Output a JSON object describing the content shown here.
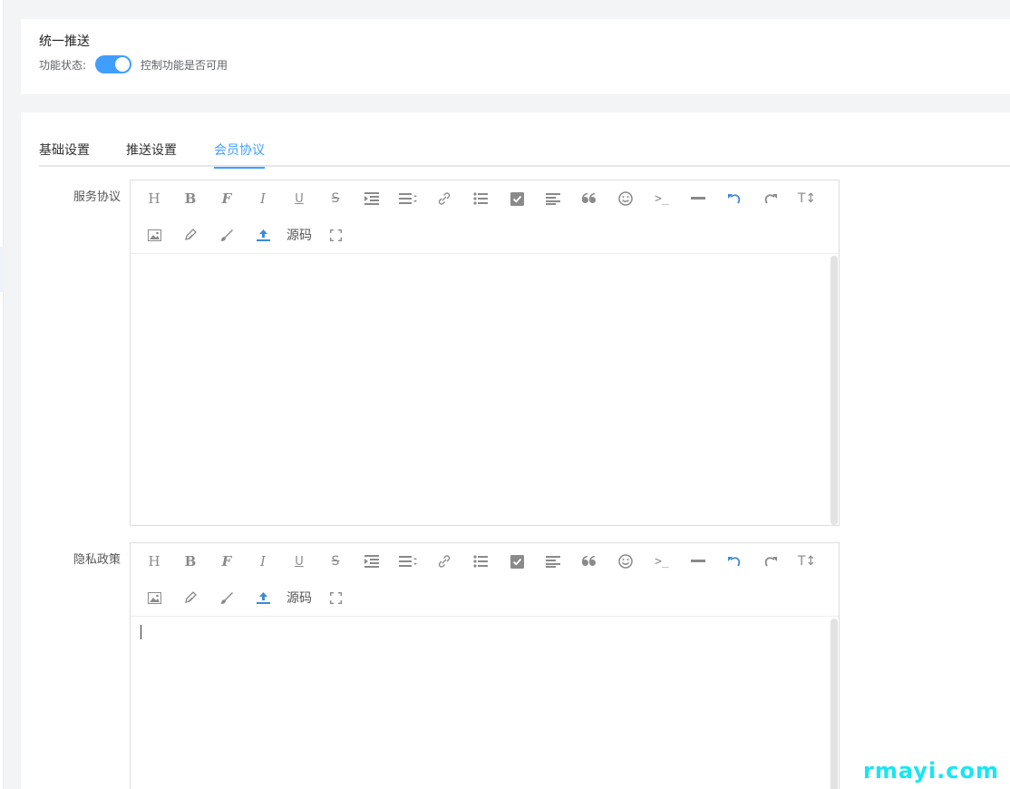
{
  "header": {
    "title": "统一推送",
    "status_label": "功能状态:",
    "status_hint": "控制功能是否可用",
    "enabled": true
  },
  "tabs": [
    {
      "label": "基础设置",
      "active": false
    },
    {
      "label": "推送设置",
      "active": false
    },
    {
      "label": "会员协议",
      "active": true
    }
  ],
  "fields": [
    {
      "label": "服务协议",
      "content": ""
    },
    {
      "label": "隐私政策",
      "content": ""
    }
  ],
  "toolbar": {
    "row1": [
      "heading-icon",
      "bold-icon",
      "font-icon",
      "italic-icon",
      "underline-icon",
      "strikethrough-icon",
      "indent-icon",
      "align-icon",
      "link-icon",
      "list-icon",
      "checkbox-icon",
      "paragraph-align-icon",
      "quote-icon",
      "emoji-icon",
      "code-icon",
      "hr-icon",
      "undo-icon",
      "redo-icon",
      "text-size-icon"
    ],
    "row2": [
      "image-icon",
      "pen-icon",
      "brush-icon",
      "upload-icon",
      "source-button",
      "fullscreen-icon"
    ],
    "source_label": "源码",
    "accent": "#3c8ad6"
  },
  "watermark": "rmayi.com",
  "colors": {
    "primary": "#409eff"
  }
}
